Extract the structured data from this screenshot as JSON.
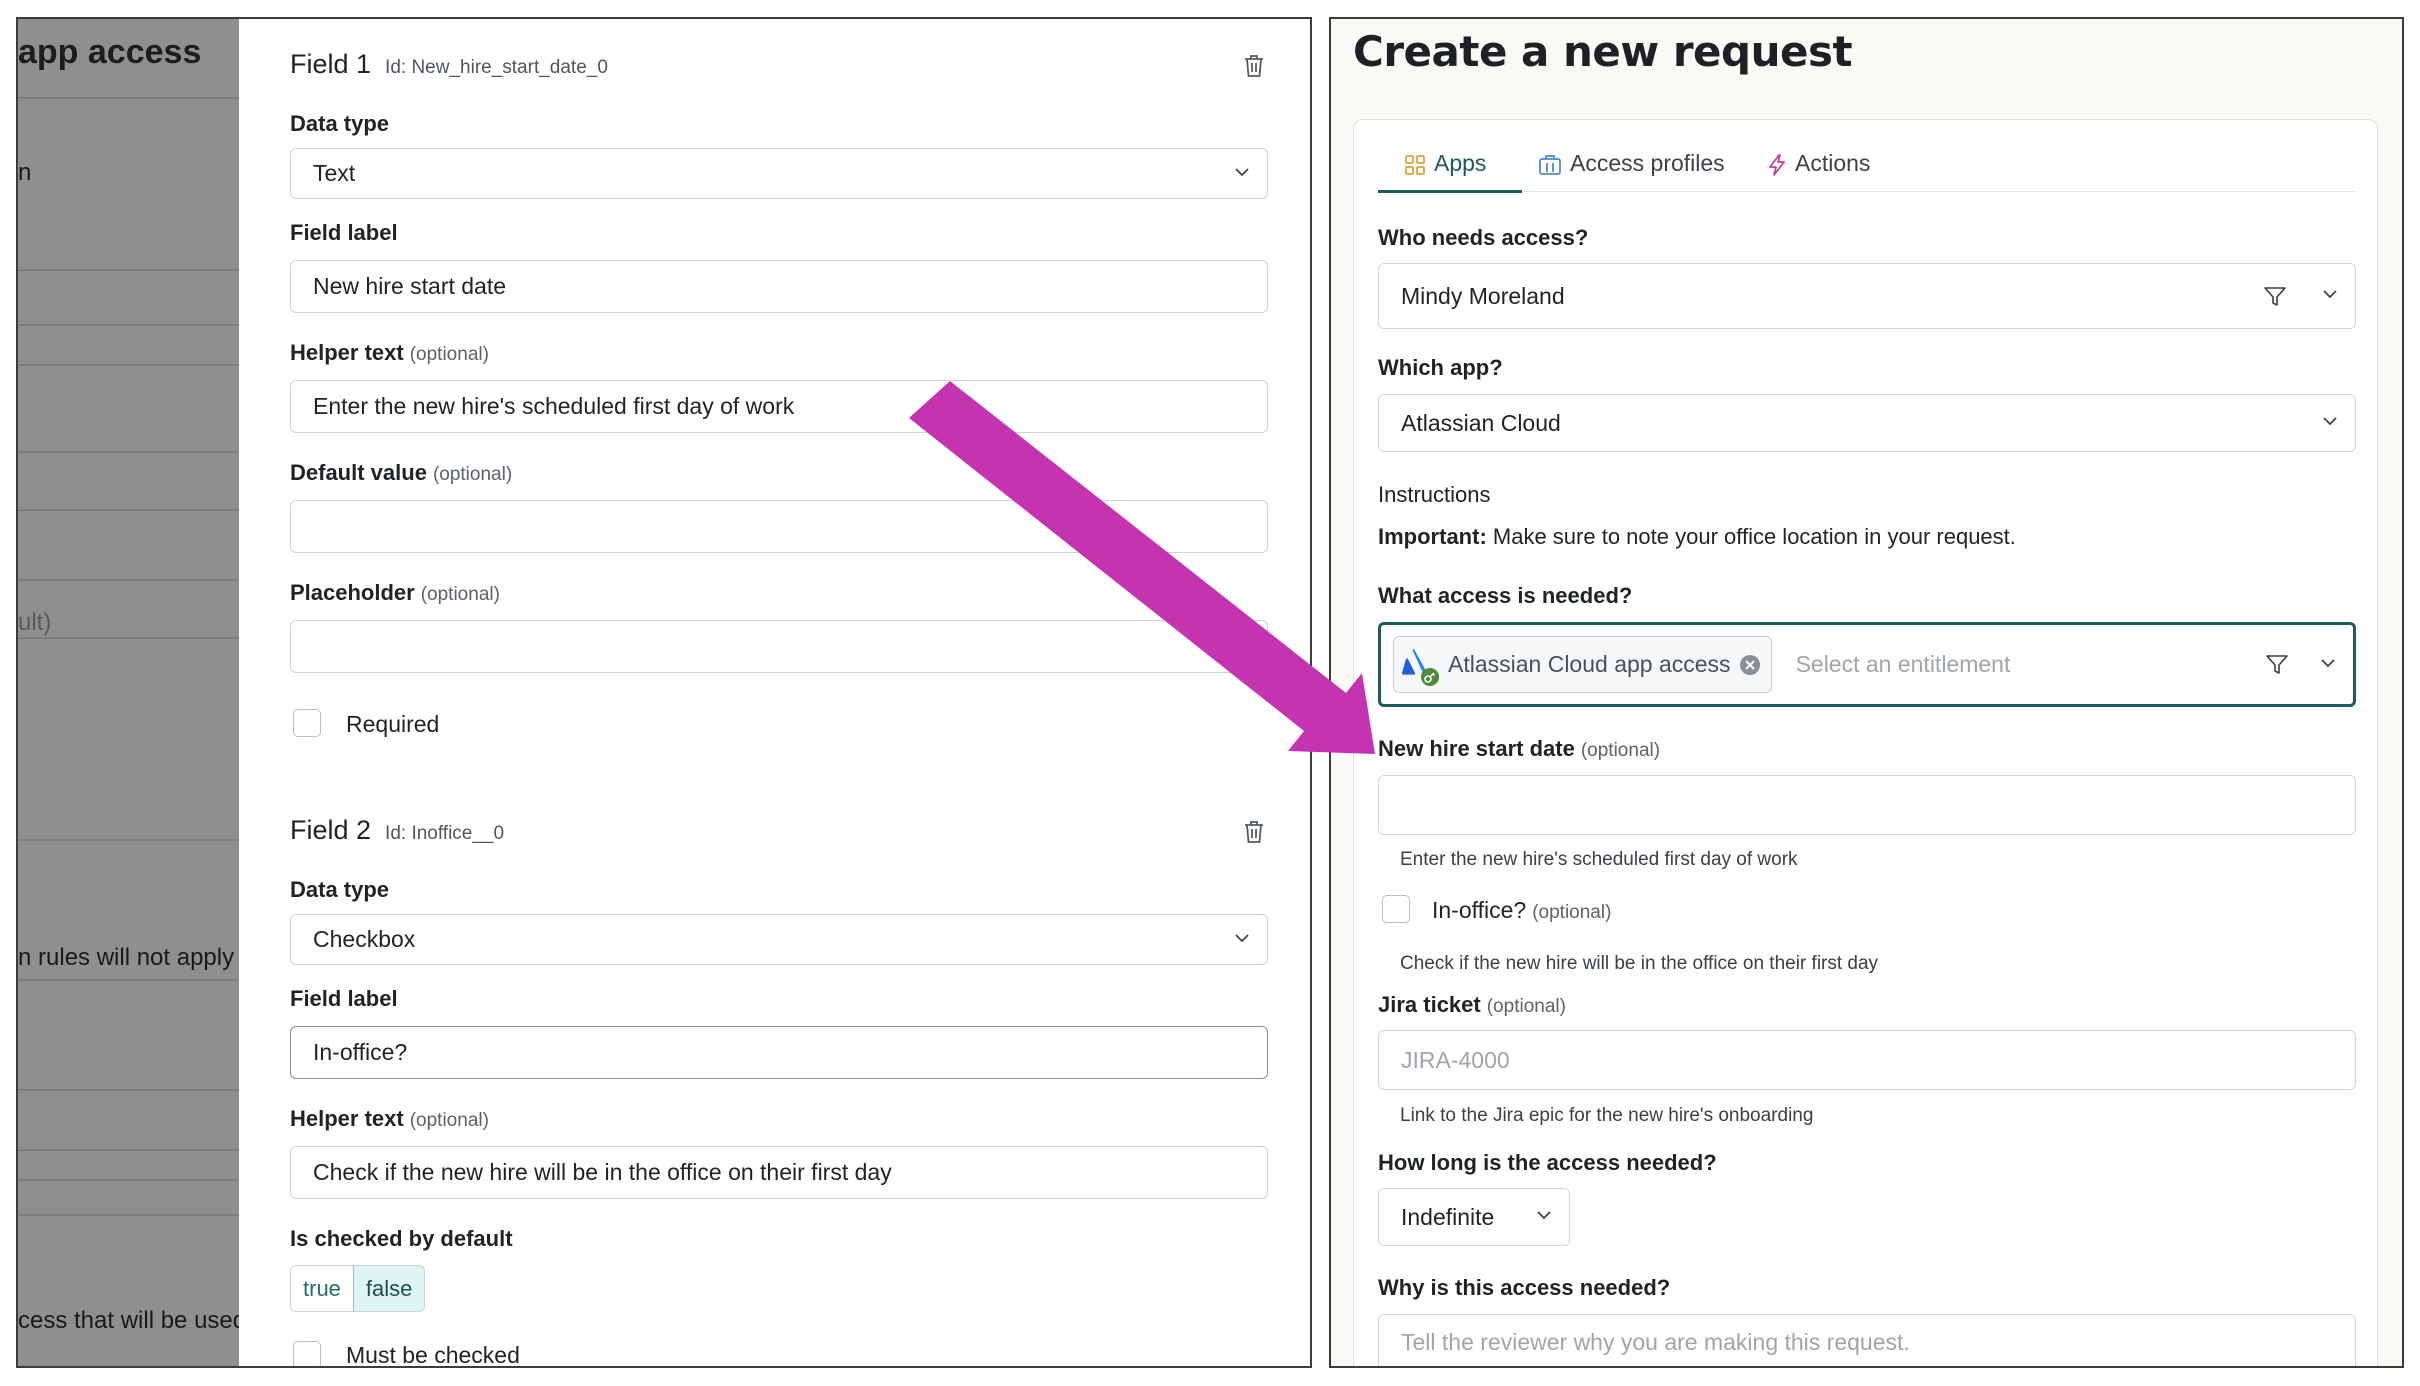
{
  "background_page": {
    "title": "app access",
    "texts": [
      "n",
      "ult)",
      "n rules will not apply",
      "cess that will be used"
    ]
  },
  "field_editor": {
    "fields": [
      {
        "title": "Field 1",
        "id_text": "Id: New_hire_start_date_0",
        "data_type_label": "Data type",
        "data_type_value": "Text",
        "field_label_label": "Field label",
        "field_label_value": "New hire start date",
        "helper_label": "Helper text",
        "helper_value": "Enter the new hire's scheduled first day of work",
        "default_label": "Default value",
        "default_value": "",
        "placeholder_label": "Placeholder",
        "placeholder_value": "",
        "required_label": "Required",
        "optional_tag": "(optional)"
      },
      {
        "title": "Field 2",
        "id_text": "Id: Inoffice__0",
        "data_type_label": "Data type",
        "data_type_value": "Checkbox",
        "field_label_label": "Field label",
        "field_label_value": "In-office?",
        "helper_label": "Helper text",
        "helper_value": "Check if the new hire will be in the office on their first day",
        "checked_default_label": "Is checked by default",
        "toggle_true": "true",
        "toggle_false": "false",
        "toggle_selected": "false",
        "must_be_checked_label": "Must be checked",
        "optional_tag": "(optional)"
      }
    ]
  },
  "request_form": {
    "title": "Create a new request",
    "tabs": [
      {
        "label": "Apps",
        "icon": "grid-icon",
        "active": true
      },
      {
        "label": "Access profiles",
        "icon": "building-icon",
        "active": false
      },
      {
        "label": "Actions",
        "icon": "lightning-icon",
        "active": false
      }
    ],
    "who_label": "Who needs access?",
    "who_value": "Mindy Moreland",
    "app_label": "Which app?",
    "app_value": "Atlassian Cloud",
    "instructions_label": "Instructions",
    "instructions_bold": "Important:",
    "instructions_text": "Make sure to note your office location in your request.",
    "access_label": "What access is needed?",
    "access_chip": "Atlassian Cloud app access",
    "access_placeholder": "Select an entitlement",
    "start_date_label": "New hire start date",
    "start_date_value": "",
    "start_date_help": "Enter the new hire's scheduled first day of work",
    "inoffice_label": "In-office?",
    "inoffice_help": "Check if the new hire will be in the office on their first day",
    "jira_label": "Jira ticket",
    "jira_placeholder": "JIRA-4000",
    "jira_help": "Link to the Jira epic for the new hire's onboarding",
    "duration_label": "How long is the access needed?",
    "duration_value": "Indefinite",
    "why_label": "Why is this access needed?",
    "why_placeholder": "Tell the reviewer why you are making this request.",
    "optional_tag": "(optional)"
  },
  "colors": {
    "accent": "#1c5c5c",
    "annotation_arrow": "#c534b0",
    "toggle_selected_bg": "#dff5f3"
  }
}
